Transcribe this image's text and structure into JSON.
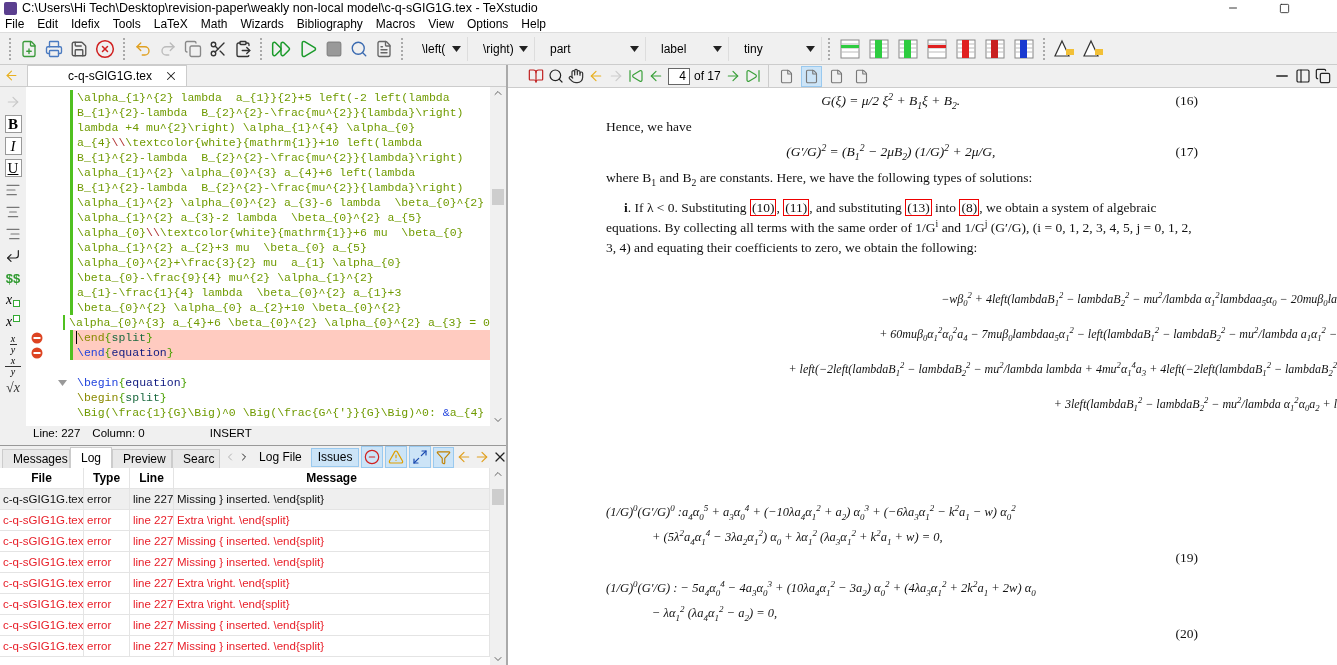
{
  "window": {
    "title": "C:\\Users\\Hi Tech\\Desktop\\revision-paper\\weakly non-local model\\c-q-sGIG1G.tex - TeXstudio"
  },
  "menu": [
    "File",
    "Edit",
    "Idefix",
    "Tools",
    "LaTeX",
    "Math",
    "Wizards",
    "Bibliography",
    "Macros",
    "View",
    "Options",
    "Help"
  ],
  "toolbar": {
    "dropdowns": [
      "\\left(",
      "\\right)",
      "part",
      "label",
      "tiny"
    ]
  },
  "editor": {
    "tab": {
      "label": "c-q-sGIG1G.tex",
      "selected": true
    },
    "side_tools": [
      {
        "kind": "forward"
      },
      {
        "kind": "bold",
        "label": "B"
      },
      {
        "kind": "italic",
        "label": "I"
      },
      {
        "kind": "underline",
        "label": "U"
      },
      {
        "kind": "align-left"
      },
      {
        "kind": "align-center"
      },
      {
        "kind": "align-right"
      },
      {
        "kind": "newline"
      },
      {
        "kind": "math",
        "label": "$$"
      },
      {
        "kind": "subscript",
        "label": "x"
      },
      {
        "kind": "superscript",
        "label": "x"
      },
      {
        "kind": "fraction",
        "label": "x",
        "label2": "y"
      },
      {
        "kind": "dfraction",
        "label": "x",
        "label2": "y"
      },
      {
        "kind": "sqrt",
        "label": "√x"
      }
    ],
    "lines": [
      {
        "kind": "code",
        "modified": true,
        "error": false,
        "foldable": false,
        "segments": [
          {
            "kind": "math",
            "text": "\\alpha_{1}^{2} lambda  a_{1}}{2}+5 left(-2 left(lambda"
          }
        ]
      },
      {
        "kind": "code",
        "modified": true,
        "error": false,
        "foldable": false,
        "segments": [
          {
            "kind": "math",
            "text": "B_{1}^{2}-lambda  B_{2}^{2}-\\frac{mu^{2}}{lambda}\\right)"
          }
        ]
      },
      {
        "kind": "code",
        "modified": true,
        "error": false,
        "foldable": false,
        "segments": [
          {
            "kind": "math",
            "text": "lambda +4 mu^{2}\\right) \\alpha_{1}^{4} \\alpha_{0}"
          }
        ]
      },
      {
        "kind": "code",
        "modified": true,
        "error": false,
        "foldable": false,
        "segments": [
          {
            "kind": "math",
            "text": "a_{4}"
          },
          {
            "kind": "linebreak",
            "text": "\\\\"
          },
          {
            "kind": "math",
            "text": "\\textcolor{white}{mathrm{1}}+10 left(lambda"
          }
        ]
      },
      {
        "kind": "code",
        "modified": true,
        "error": false,
        "foldable": false,
        "segments": [
          {
            "kind": "math",
            "text": "B_{1}^{2}-lambda  B_{2}^{2}-\\frac{mu^{2}}{lambda}\\right)"
          }
        ]
      },
      {
        "kind": "code",
        "modified": true,
        "error": false,
        "foldable": false,
        "segments": [
          {
            "kind": "math",
            "text": "\\alpha_{1}^{2} \\alpha_{0}^{3} a_{4}+6 left(lambda"
          }
        ]
      },
      {
        "kind": "code",
        "modified": true,
        "error": false,
        "foldable": false,
        "segments": [
          {
            "kind": "math",
            "text": "B_{1}^{2}-lambda  B_{2}^{2}-\\frac{mu^{2}}{lambda}\\right)"
          }
        ]
      },
      {
        "kind": "code",
        "modified": true,
        "error": false,
        "foldable": false,
        "segments": [
          {
            "kind": "math",
            "text": "\\alpha_{1}^{2} \\alpha_{0}^{2} a_{3}-6 lambda  \\beta_{0}^{2}"
          }
        ]
      },
      {
        "kind": "code",
        "modified": true,
        "error": false,
        "foldable": false,
        "segments": [
          {
            "kind": "math",
            "text": "\\alpha_{1}^{2} a_{3}-2 lambda  \\beta_{0}^{2} a_{5}"
          }
        ]
      },
      {
        "kind": "code",
        "modified": true,
        "error": false,
        "foldable": false,
        "segments": [
          {
            "kind": "math",
            "text": "\\alpha_{0}"
          },
          {
            "kind": "linebreak",
            "text": "\\\\"
          },
          {
            "kind": "math",
            "text": "\\textcolor{white}{mathrm{1}}+6 mu  \\beta_{0}"
          }
        ]
      },
      {
        "kind": "code",
        "modified": true,
        "error": false,
        "foldable": false,
        "segments": [
          {
            "kind": "math",
            "text": "\\alpha_{1}^{2} a_{2}+3 mu  \\beta_{0} a_{5}"
          }
        ]
      },
      {
        "kind": "code",
        "modified": true,
        "error": false,
        "foldable": false,
        "segments": [
          {
            "kind": "math",
            "text": "\\alpha_{0}^{2}+\\frac{3}{2} mu  a_{1} \\alpha_{0}"
          }
        ]
      },
      {
        "kind": "code",
        "modified": true,
        "error": false,
        "foldable": false,
        "segments": [
          {
            "kind": "math",
            "text": "\\beta_{0}-\\frac{9}{4} mu^{2} \\alpha_{1}^{2}"
          }
        ]
      },
      {
        "kind": "code",
        "modified": true,
        "error": false,
        "foldable": false,
        "segments": [
          {
            "kind": "math",
            "text": "a_{1}-\\frac{1}{4} lambda  \\beta_{0}^{2} a_{1}+3"
          }
        ]
      },
      {
        "kind": "code",
        "modified": true,
        "error": false,
        "foldable": false,
        "segments": [
          {
            "kind": "math",
            "text": "\\beta_{0}^{2} \\alpha_{0} a_{2}+10 \\beta_{0}^{2}"
          }
        ]
      },
      {
        "kind": "code",
        "modified": true,
        "error": false,
        "foldable": false,
        "segments": [
          {
            "kind": "math",
            "text": "\\alpha_{0}^{3} a_{4}+6 \\beta_{0}^{2} \\alpha_{0}^{2} a_{3} = 0"
          }
        ]
      },
      {
        "kind": "code",
        "modified": true,
        "error": true,
        "foldable": false,
        "segments": [
          {
            "kind": "command",
            "text": "\\end"
          },
          {
            "kind": "brace",
            "text": "{"
          },
          {
            "kind": "env",
            "text": "split"
          },
          {
            "kind": "brace",
            "text": "}"
          }
        ]
      },
      {
        "kind": "code",
        "modified": true,
        "error": true,
        "foldable": false,
        "segments": [
          {
            "kind": "keyword",
            "text": "\\end"
          },
          {
            "kind": "brace",
            "text": "{"
          },
          {
            "kind": "main-env",
            "text": "equation"
          },
          {
            "kind": "brace",
            "text": "}"
          }
        ]
      },
      {
        "kind": "blank",
        "modified": false,
        "error": false,
        "foldable": false
      },
      {
        "kind": "code",
        "modified": false,
        "error": false,
        "foldable": true,
        "segments": [
          {
            "kind": "keyword",
            "text": "\\begin"
          },
          {
            "kind": "brace",
            "text": "{"
          },
          {
            "kind": "main-env",
            "text": "equation"
          },
          {
            "kind": "brace",
            "text": "}"
          }
        ]
      },
      {
        "kind": "code",
        "modified": false,
        "error": false,
        "foldable": false,
        "segments": [
          {
            "kind": "command",
            "text": "\\begin"
          },
          {
            "kind": "brace",
            "text": "{"
          },
          {
            "kind": "env",
            "text": "split"
          },
          {
            "kind": "brace",
            "text": "}"
          }
        ]
      },
      {
        "kind": "code",
        "modified": false,
        "error": false,
        "foldable": false,
        "segments": [
          {
            "kind": "math",
            "text": "\\Big(\\frac{1}{G}\\Big)^0 \\Big(\\frac{G^{'}}{G}\\Big)^0: "
          },
          {
            "kind": "keyword",
            "text": "&"
          },
          {
            "kind": "math",
            "text": "a_{4}"
          }
        ]
      }
    ],
    "status": {
      "line": "Line: 227",
      "column": "Column: 0",
      "mode": "INSERT"
    }
  },
  "log_panel": {
    "tabs": [
      {
        "label": "Messages",
        "selected": false
      },
      {
        "label": "Log",
        "selected": true
      },
      {
        "label": "Preview",
        "selected": false
      },
      {
        "label": "Searc",
        "selected": false
      }
    ],
    "buttons": [
      {
        "label": "Log File",
        "selected": false
      },
      {
        "label": "Issues",
        "selected": true
      }
    ],
    "filters": [
      {
        "kind": "error",
        "on": true
      },
      {
        "kind": "warning",
        "on": true
      },
      {
        "kind": "badbox",
        "on": true
      }
    ],
    "columns": [
      "File",
      "Type",
      "Line",
      "Message"
    ],
    "rows": [
      {
        "file": "c-q-sGIG1G.tex",
        "type": "error",
        "line": "line 227",
        "message": "Missing } inserted. \\end{split}",
        "selected": true
      },
      {
        "file": "c-q-sGIG1G.tex",
        "type": "error",
        "line": "line 227",
        "message": "Extra \\right. \\end{split}",
        "selected": false
      },
      {
        "file": "c-q-sGIG1G.tex",
        "type": "error",
        "line": "line 227",
        "message": "Missing { inserted. \\end{split}",
        "selected": false
      },
      {
        "file": "c-q-sGIG1G.tex",
        "type": "error",
        "line": "line 227",
        "message": "Missing } inserted. \\end{split}",
        "selected": false
      },
      {
        "file": "c-q-sGIG1G.tex",
        "type": "error",
        "line": "line 227",
        "message": "Extra \\right. \\end{split}",
        "selected": false
      },
      {
        "file": "c-q-sGIG1G.tex",
        "type": "error",
        "line": "line 227",
        "message": "Extra \\right. \\end{split}",
        "selected": false
      },
      {
        "file": "c-q-sGIG1G.tex",
        "type": "error",
        "line": "line 227",
        "message": "Missing { inserted. \\end{split}",
        "selected": false
      },
      {
        "file": "c-q-sGIG1G.tex",
        "type": "error",
        "line": "line 227",
        "message": "Missing } inserted. \\end{split}",
        "selected": false
      }
    ]
  },
  "pdf": {
    "page_input": "4",
    "page_count": "of 17",
    "view_modes": [
      {
        "selected": false
      },
      {
        "selected": true
      },
      {
        "selected": false
      },
      {
        "selected": false
      }
    ],
    "blocks": [
      {
        "kind": "equation",
        "number_below": false,
        "lines": [
          "G(ξ) = μ/2 ξ$^{2}$ + B$_{1}$ξ + B$_{2}$."
        ],
        "number": "(16)"
      },
      {
        "kind": "text",
        "indent": false,
        "segments": [
          {
            "kind": "text",
            "text": "Hence, we have"
          }
        ]
      },
      {
        "kind": "equation",
        "number_below": false,
        "lines": [
          "(G′/G)$^{2}$ = (B$_{1}$$^{2}$ − 2μB$_{2}$) (1/G)$^{2}$ + 2μ/G,"
        ],
        "number": "(17)"
      },
      {
        "kind": "text",
        "indent": false,
        "segments": [
          {
            "kind": "text",
            "text": "where B$_{1}$ and B$_{2}$ are constants. Here, we have the following types of solutions:"
          }
        ]
      },
      {
        "kind": "text",
        "indent": true,
        "segments": [
          {
            "kind": "text",
            "text": "**i**. If λ < 0. Substituting "
          },
          {
            "kind": "ref",
            "text": "(10)"
          },
          {
            "kind": "text",
            "text": ", "
          },
          {
            "kind": "ref",
            "text": "(11)"
          },
          {
            "kind": "text",
            "text": ", and substituting "
          },
          {
            "kind": "ref",
            "text": "(13)"
          },
          {
            "kind": "text",
            "text": " into "
          },
          {
            "kind": "ref",
            "text": "(8)"
          },
          {
            "kind": "text",
            "text": ", we obtain a system of algebraic equations. By collecting all terms with the same order of 1/G$^{i}$ and 1/G$^{j}$ (G′/G), (i = 0, 1, 2, 3, 4, 5, j = 0, 1, 2, 3, 4) and equating their coefficients to zero, we obtain the following:"
          }
        ]
      },
      {
        "kind": "wide-equation",
        "lines": [
          "−wβ$_{0}$$^{2}$ + 4left(lambdaB$_{1}$$^{2}$ − lambdaB$_{2}$$^{2}$ − mu$^{2}$/lambda α$_{1}$$^{2}$lambdaa$_{5}$α$_{0}$ − 20muβ$_{0}$la",
          "+ 60muβ$_{0}$α$_{1}$$^{2}$α$_{0}$$^{2}$a$_{4}$ − 7muβ$_{0}$lambdaa$_{5}$α$_{1}$$^{2}$ − left(lambdaB$_{1}$$^{2}$ − lambdaB$_{2}$$^{2}$ − mu$^{2}$/lambda a$_{1}$α$_{1}$$^{2}$ −",
          "+ left(−2left(lambdaB$_{1}$$^{2}$ − lambdaB$_{2}$$^{2}$ − mu$^{2}$/lambda lambda + 4mu$^{2}$α$_{1}$$^{4}$a$_{3}$ + 4left(−2left(lambdaB$_{1}$$^{2}$ − lambdaB$_{2}$$^{2}$",
          "+ 3left(lambdaB$_{1}$$^{2}$ − lambdaB$_{2}$$^{2}$ − mu$^{2}$/lambda α$_{1}$$^{2}$α$_{0}$a$_{2}$ + l"
        ]
      },
      {
        "kind": "equation",
        "number_below": true,
        "lines": [
          "(1/G)$^{0}$(G′/G)$^{0}$ :a$_{4}$α$_{0}$$^{5}$ + a$_{3}$α$_{0}$$^{4}$ + (−10λa$_{4}$α$_{1}$$^{2}$ + a$_{2}$) α$_{0}$$^{3}$ + (−6λa$_{3}$α$_{1}$$^{2}$ − k$^{2}$a$_{1}$ − w) α$_{0}$$^{2}$",
          "+ (5λ$^{2}$a$_{4}$α$_{1}$$^{4}$ − 3λa$_{2}$α$_{1}$$^{2}$) α$_{0}$ + λα$_{1}$$^{2}$ (λa$_{3}$α$_{1}$$^{2}$ + k$^{2}$a$_{1}$ + w) = 0,"
        ],
        "number": "(19)"
      },
      {
        "kind": "equation",
        "number_below": true,
        "lines": [
          "(1/G)$^{0}$(G′/G) : − 5a$_{4}$α$_{0}$$^{4}$ − 4a$_{3}$α$_{0}$$^{3}$ + (10λa$_{4}$α$_{1}$$^{2}$ − 3a$_{2}$) α$_{0}$$^{2}$ + (4λa$_{3}$α$_{1}$$^{2}$ + 2k$^{2}$a$_{1}$ + 2w) α$_{0}$",
          "− λα$_{1}$$^{2}$ (λa$_{4}$α$_{1}$$^{2}$ − a$_{2}$) = 0,"
        ],
        "number": "(20)"
      }
    ]
  }
}
